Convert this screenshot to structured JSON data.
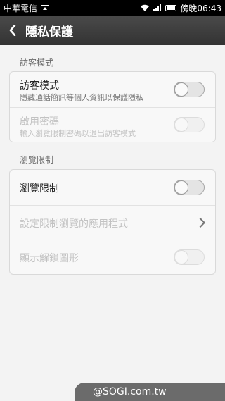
{
  "statusbar": {
    "carrier": "中華電信",
    "clock": "傍晚06:43"
  },
  "header": {
    "title": "隱私保護"
  },
  "sections": {
    "guest": {
      "title": "訪客模式",
      "rows": [
        {
          "label": "訪客模式",
          "sublabel": "隱藏通話簡訊等個人資訊以保護隱私"
        },
        {
          "label": "啟用密碼",
          "sublabel": "輸入瀏覽限制密碼以退出訪客模式"
        }
      ]
    },
    "browse": {
      "title": "瀏覽限制",
      "rows": [
        {
          "label": "瀏覽限制"
        },
        {
          "label": "設定限制瀏覽的應用程式"
        },
        {
          "label": "顯示解鎖圖形"
        }
      ]
    }
  },
  "watermark": "@SOGI.com.tw"
}
